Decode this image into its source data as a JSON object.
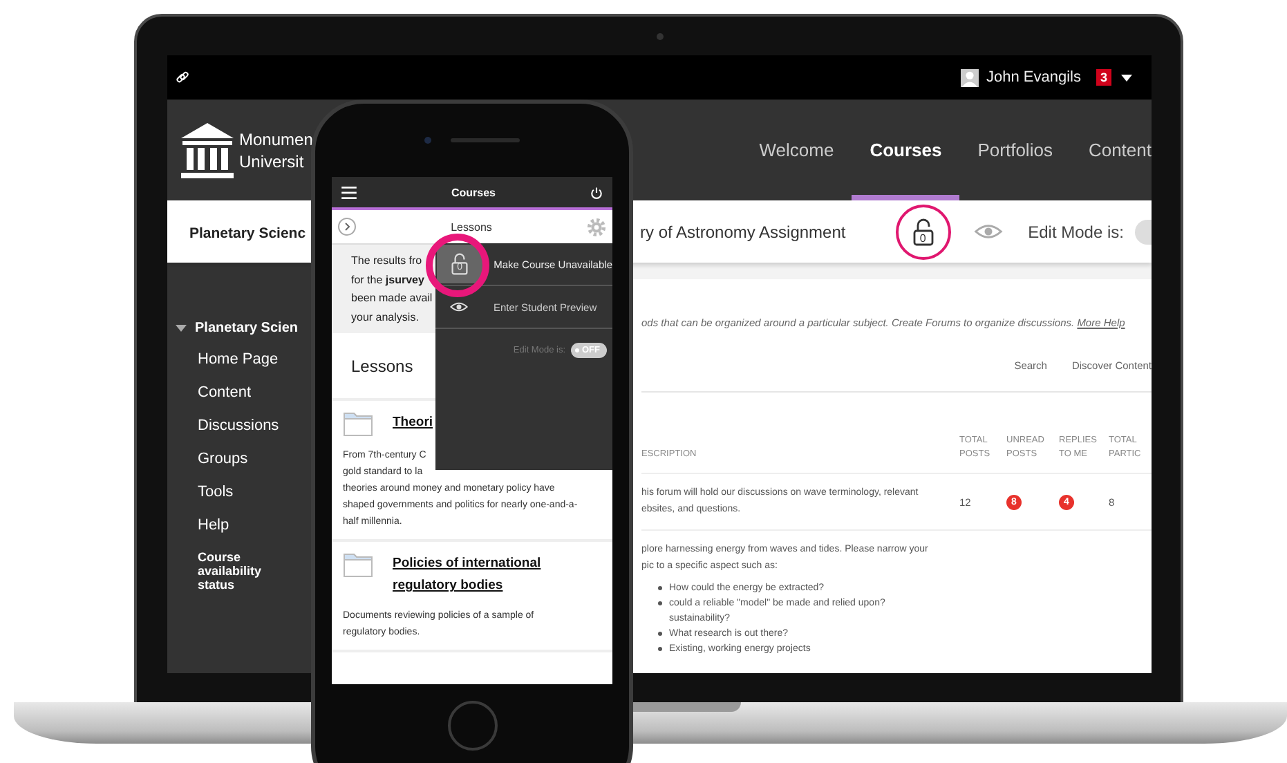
{
  "laptop": {
    "top_bar": {
      "user_name": "John Evangils",
      "notification_count": "3"
    },
    "header": {
      "institution_lines": [
        "Monumen",
        "Universit"
      ],
      "nav": [
        {
          "label": "Welcome",
          "selected": false
        },
        {
          "label": "Courses",
          "selected": true
        },
        {
          "label": "Portfolios",
          "selected": false
        },
        {
          "label": "Content",
          "selected": false
        }
      ]
    },
    "course_bar": {
      "course_title": "Planetary Scienc",
      "page_title": "ry of Astronomy Assignment",
      "lock_count": "0",
      "lock_highlighted": true,
      "edit_mode_label": "Edit Mode is:",
      "edit_mode_on": false
    },
    "sidebar": {
      "course": {
        "label": "Planetary Scien",
        "expanded": true
      },
      "items": [
        "Home Page",
        "Content",
        "Discussions",
        "Groups",
        "Tools",
        "Help",
        "Course availability status"
      ]
    },
    "content": {
      "intro": "ods that can be organized around a particular subject. Create Forums to organize discussions.",
      "help_link": "More Help",
      "actions": [
        "Search",
        "Discover Content"
      ],
      "table": {
        "columns": [
          "ESCRIPTION",
          "TOTAL POSTS",
          "UNREAD POSTS",
          "REPLIES TO ME",
          "TOTAL PARTIC"
        ],
        "rows": [
          {
            "description_lines": [
              "his forum will hold our discussions on wave terminology, relevant",
              "ebsites, and questions."
            ],
            "total_posts": "12",
            "unread_posts": "8",
            "replies_to_me": "4",
            "total_participants": "8"
          },
          {
            "description_lines": [
              "plore harnessing energy from waves and tides. Please narrow your",
              "pic to a specific aspect such as:"
            ],
            "bullets": [
              "How could the energy be extracted?",
              "could a reliable \"model\" be made and relied upon? sustainability?",
              "What research is out there?",
              "Existing, working energy projects"
            ]
          }
        ]
      }
    }
  },
  "phone": {
    "header_title": "Courses",
    "sub_title": "Lessons",
    "notice_lines": [
      "The results fro",
      "for the **jsurvey**",
      "been made avail",
      "your analysis."
    ],
    "section_title": "Lessons",
    "lessons": [
      {
        "title": "Theori",
        "description_lines": [
          "From 7th-century C",
          "gold standard to la",
          "theories around money and monetary policy have",
          "shaped governments and politics for nearly one-and-a-",
          "half millennia."
        ]
      },
      {
        "title": "Policies of international regulatory bodies",
        "description_lines": [
          "Documents reviewing policies of a sample of",
          "regulatory bodies."
        ]
      }
    ],
    "menu": {
      "items": [
        {
          "kind": "lock",
          "label": "Make Course Unavailable",
          "lock_count": "0",
          "highlighted": true
        },
        {
          "kind": "preview",
          "label": "Enter Student Preview",
          "highlighted": false
        }
      ],
      "edit_mode_label": "Edit Mode is:",
      "edit_mode_toggle": {
        "label": "OFF",
        "on": false
      }
    }
  }
}
